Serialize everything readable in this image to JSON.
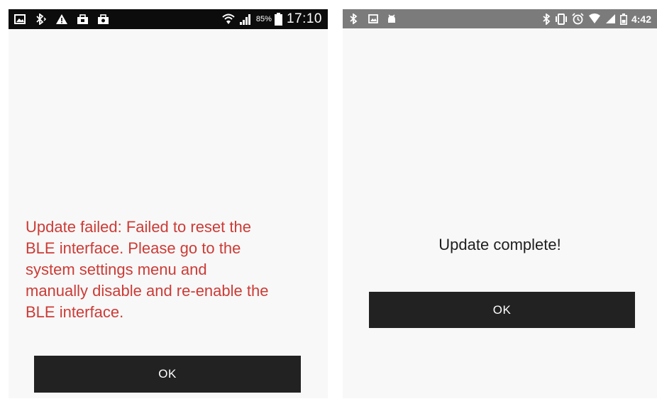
{
  "left_screen": {
    "status_bar": {
      "left_icons": [
        "image-icon",
        "bluetooth-icon",
        "warning-icon",
        "briefcase-icon",
        "briefcase-alt-icon"
      ],
      "right_icons": [
        "wifi-icon",
        "signal-icon",
        "battery-icon"
      ],
      "battery_percent": "85%",
      "clock": "17:10"
    },
    "message": "Update failed: Failed to reset the\nBLE interface.  Please go to the\nsystem settings menu and\nmanually disable and re-enable the\nBLE interface.",
    "message_color": "#cc3b36",
    "button_label": "OK"
  },
  "right_screen": {
    "status_bar": {
      "left_icons": [
        "bluetooth-icon",
        "image-icon",
        "android-icon"
      ],
      "right_icons": [
        "bluetooth-icon",
        "vibrate-icon",
        "alarm-icon",
        "wifi-icon",
        "signal-icon",
        "battery-icon"
      ],
      "clock": "4:42"
    },
    "message": "Update complete!",
    "button_label": "OK"
  },
  "colors": {
    "background": "#f8f8f8",
    "button": "#222222",
    "button_text": "#ffffff",
    "left_status_bar": "#0c0c0c",
    "right_status_bar": "#7b7b7b"
  }
}
